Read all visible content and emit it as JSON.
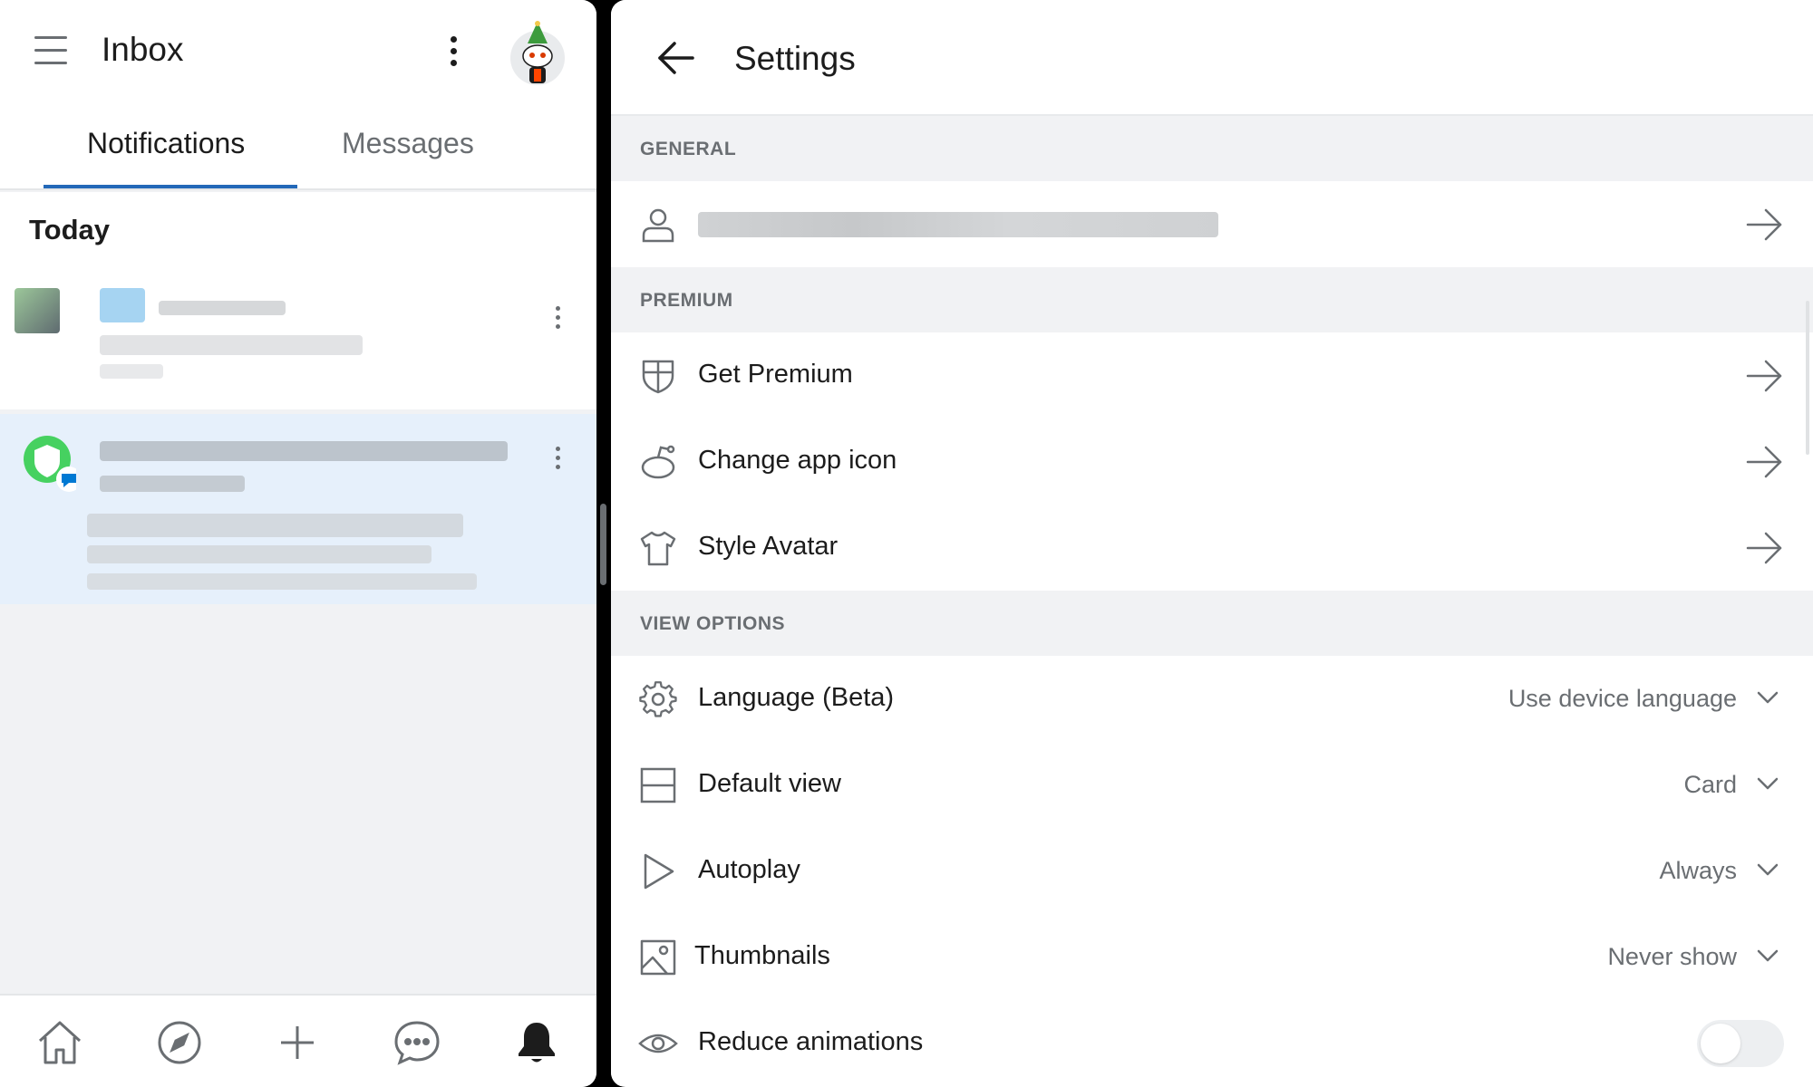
{
  "inbox": {
    "title": "Inbox",
    "tabs": [
      {
        "label": "Notifications",
        "selected": true
      },
      {
        "label": "Messages",
        "selected": false
      }
    ],
    "section_label": "Today",
    "bottom_nav": [
      "home-icon",
      "explore-compass-icon",
      "create-plus-icon",
      "chat-icon",
      "notifications-bell-icon"
    ]
  },
  "settings": {
    "title": "Settings",
    "sections": {
      "general": "GENERAL",
      "premium": "PREMIUM",
      "view_options": "VIEW OPTIONS"
    },
    "premium_items": [
      {
        "label": "Get Premium",
        "icon": "shield-icon"
      },
      {
        "label": "Change app icon",
        "icon": "snoo-icon"
      },
      {
        "label": "Style Avatar",
        "icon": "tshirt-icon"
      }
    ],
    "view_items": [
      {
        "label": "Language (Beta)",
        "value": "Use device language",
        "icon": "gear-icon"
      },
      {
        "label": "Default view",
        "value": "Card",
        "icon": "layout-icon"
      },
      {
        "label": "Autoplay",
        "value": "Always",
        "icon": "play-icon"
      },
      {
        "label": "Thumbnails",
        "value": "Never show",
        "icon": "image-icon"
      },
      {
        "label": "Reduce animations",
        "toggle": false,
        "icon": "eye-icon"
      }
    ]
  },
  "colors": {
    "accent": "#2368b8",
    "selected_row": "#e6f0fb",
    "section_bg": "#f1f2f4",
    "muted_text": "#6a6e72"
  }
}
